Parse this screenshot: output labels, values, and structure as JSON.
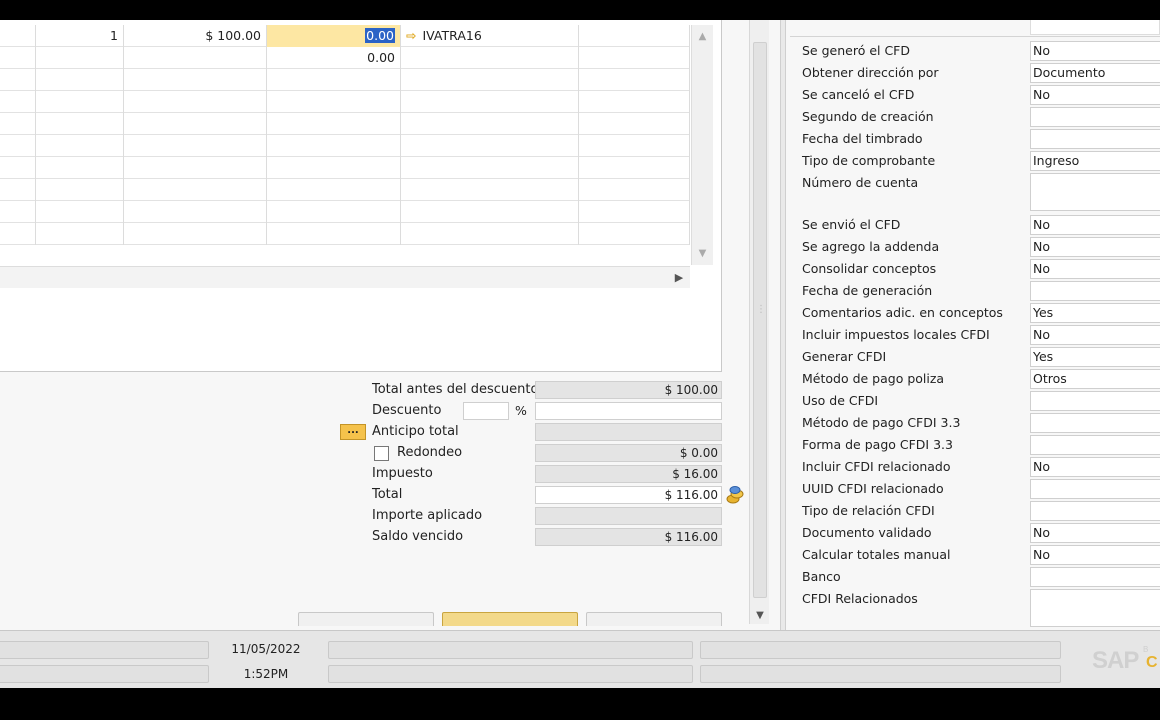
{
  "grid": {
    "rows": [
      {
        "qty": "1",
        "price": "$ 100.00",
        "discount": "0.00",
        "tax_code": "IVATRA16"
      },
      {
        "qty": "",
        "price": "",
        "discount": "0.00",
        "tax_code": ""
      },
      {
        "qty": "",
        "price": "",
        "discount": "",
        "tax_code": ""
      },
      {
        "qty": "",
        "price": "",
        "discount": "",
        "tax_code": ""
      },
      {
        "qty": "",
        "price": "",
        "discount": "",
        "tax_code": ""
      },
      {
        "qty": "",
        "price": "",
        "discount": "",
        "tax_code": ""
      },
      {
        "qty": "",
        "price": "",
        "discount": "",
        "tax_code": ""
      },
      {
        "qty": "",
        "price": "",
        "discount": "",
        "tax_code": ""
      },
      {
        "qty": "",
        "price": "",
        "discount": "",
        "tax_code": ""
      },
      {
        "qty": "",
        "price": "",
        "discount": "",
        "tax_code": ""
      }
    ]
  },
  "totals": {
    "total_before_discount_label": "Total antes del descuento",
    "total_before_discount_value": "$ 100.00",
    "discount_label": "Descuento",
    "percent_sign": "%",
    "advance_label": "Anticipo total",
    "advance_button": "...",
    "rounding_label": "Redondeo",
    "rounding_value": "$ 0.00",
    "tax_label": "Impuesto",
    "tax_value": "$ 16.00",
    "total_label": "Total",
    "total_value": "$ 116.00",
    "applied_label": "Importe aplicado",
    "due_label": "Saldo vencido",
    "due_value": "$ 116.00"
  },
  "udf": [
    {
      "label": "Se generó el CFD",
      "value": "No"
    },
    {
      "label": "Obtener dirección por",
      "value": "Documento"
    },
    {
      "label": "Se canceló el CFD",
      "value": "No"
    },
    {
      "label": "Segundo de creación",
      "value": ""
    },
    {
      "label": "Fecha del timbrado",
      "value": ""
    },
    {
      "label": "Tipo de comprobante",
      "value": "Ingreso"
    },
    {
      "label": "Número de cuenta",
      "value": "",
      "tall": true
    },
    {
      "label": "Se envió el CFD",
      "value": "No"
    },
    {
      "label": "Se agrego la addenda",
      "value": "No"
    },
    {
      "label": "Consolidar conceptos",
      "value": "No"
    },
    {
      "label": "Fecha de generación",
      "value": ""
    },
    {
      "label": "Comentarios adic. en conceptos",
      "value": "Yes"
    },
    {
      "label": "Incluir impuestos locales CFDI",
      "value": "No"
    },
    {
      "label": "Generar CFDI",
      "value": "Yes"
    },
    {
      "label": "Método de pago poliza",
      "value": "Otros"
    },
    {
      "label": "Uso de CFDI",
      "value": ""
    },
    {
      "label": "Método de pago CFDI 3.3",
      "value": ""
    },
    {
      "label": "Forma de pago CFDI 3.3",
      "value": ""
    },
    {
      "label": "Incluir CFDI relacionado",
      "value": "No"
    },
    {
      "label": "UUID CFDI relacionado",
      "value": ""
    },
    {
      "label": "Tipo de relación CFDI",
      "value": ""
    },
    {
      "label": "Documento validado",
      "value": "No"
    },
    {
      "label": "Calcular totales manual",
      "value": "No"
    },
    {
      "label": "Banco",
      "value": ""
    },
    {
      "label": "CFDI Relacionados",
      "value": "",
      "tall": true
    }
  ],
  "status": {
    "date": "11/05/2022",
    "time": "1:52PM",
    "logo": "SAP"
  },
  "colors": {
    "active_cell": "#fde7a3",
    "selection": "#2b63c6",
    "primary_button": "#f3d98a",
    "logo_accent": "#e7b330"
  }
}
